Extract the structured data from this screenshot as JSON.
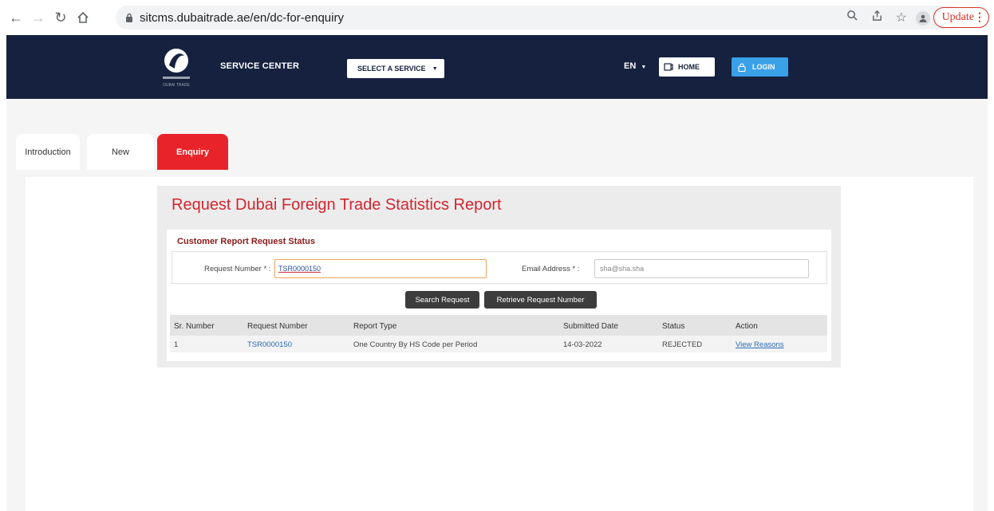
{
  "browser": {
    "url": "sitcms.dubaitrade.ae/en/dc-for-enquiry",
    "update_label": "Update"
  },
  "header": {
    "brand_caption": "DUBAI TRADE",
    "service_center": "SERVICE CENTER",
    "select_service": "SELECT A SERVICE",
    "language": "EN",
    "home": "HOME",
    "login": "LOGIN"
  },
  "tabs": [
    {
      "label": "Introduction"
    },
    {
      "label": "New"
    },
    {
      "label": "Enquiry",
      "active": true
    }
  ],
  "form": {
    "title": "Request Dubai Foreign Trade Statistics Report",
    "section_title": "Customer Report Request Status",
    "request_number_label": "Request Number * :",
    "request_number_value": "TSR0000150",
    "email_label": "Email Address * :",
    "email_value": "sha@sha.sha",
    "search_button": "Search Request",
    "retrieve_button": "Retrieve Request Number"
  },
  "table": {
    "headers": [
      "Sr. Number",
      "Request Number",
      "Report Type",
      "Submitted Date",
      "Status",
      "Action"
    ],
    "rows": [
      [
        "1",
        "TSR0000150",
        "One Country By HS Code per Period",
        "14-03-2022",
        "REJECTED",
        "View Reasons"
      ]
    ]
  },
  "colors": {
    "header_bg": "#16213f",
    "accent_red": "#e8232a",
    "login_blue": "#3aa0e8"
  }
}
